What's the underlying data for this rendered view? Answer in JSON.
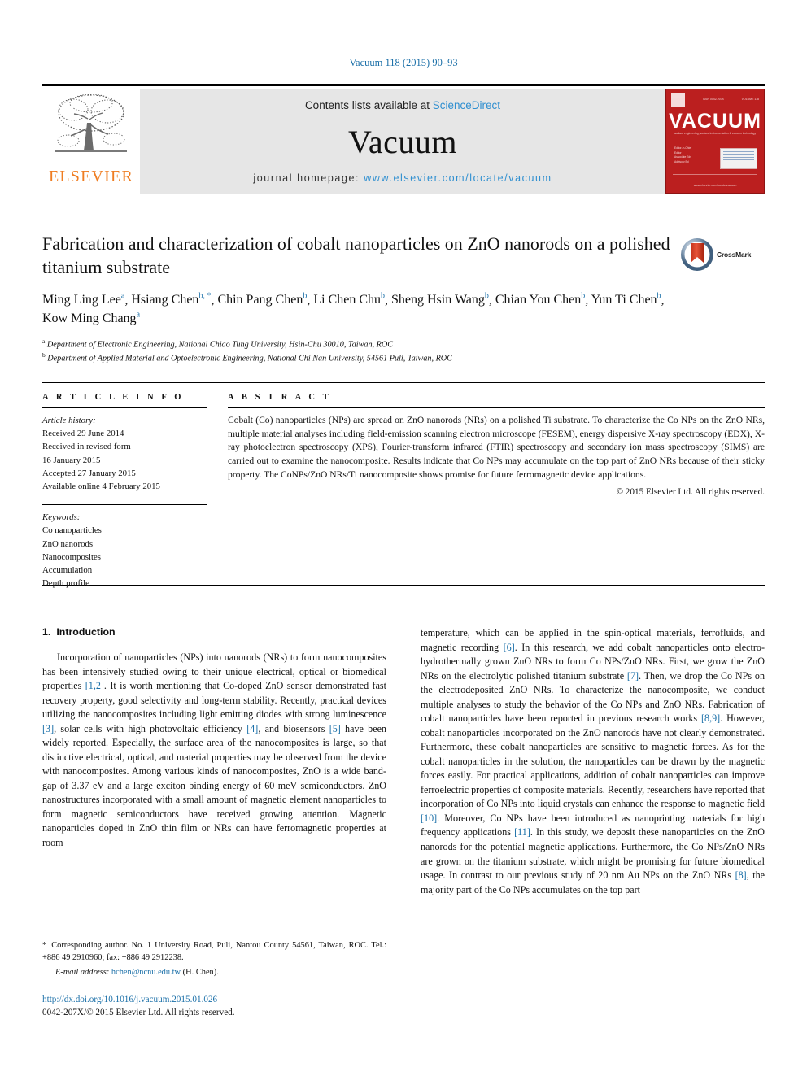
{
  "running_head": "Vacuum 118 (2015) 90–93",
  "masthead": {
    "publisher_name": "ELSEVIER",
    "publisher_logo_name": "elsevier-tree-logo",
    "contents_prefix": "Contents lists available at ",
    "contents_link": "ScienceDirect",
    "journal_title": "Vacuum",
    "homepage_prefix": "journal homepage: ",
    "homepage_url": "www.elsevier.com/locate/vacuum",
    "cover": {
      "title": "VACUUM",
      "top_left": "ELSEVIER",
      "top_center": "ISSN 0042-207X",
      "top_right": "VOLUME 118",
      "subtitle": "surface engineering, surface instrumentation & vacuum technology",
      "editors_label": "Editor-in-Chief",
      "foot": "www.elsevier.com/locate/vacuum",
      "list_left": [
        "Editor-in-Chief",
        "Editor",
        "Associate Editors",
        "Editorial Advisory"
      ],
      "list_right": [
        "J.W. Bradley",
        "R.J. Reid",
        "L.G. Pettersson",
        "M. Yamamoto",
        "M.Y. Nguyen",
        "P.J. Abrahams",
        "Review Coordinator"
      ]
    }
  },
  "article": {
    "title": "Fabrication and characterization of cobalt nanoparticles on ZnO nanorods on a polished titanium substrate",
    "authors": [
      {
        "name": "Ming Ling Lee",
        "marks": "a"
      },
      {
        "name": "Hsiang Chen",
        "marks": "b, *"
      },
      {
        "name": "Chin Pang Chen",
        "marks": "b"
      },
      {
        "name": "Li Chen Chu",
        "marks": "b"
      },
      {
        "name": "Sheng Hsin Wang",
        "marks": "b"
      },
      {
        "name": "Chian You Chen",
        "marks": "b"
      },
      {
        "name": "Yun Ti Chen",
        "marks": "b"
      },
      {
        "name": "Kow Ming Chang",
        "marks": "a"
      }
    ],
    "affiliations": [
      {
        "mark": "a",
        "text": "Department of Electronic Engineering, National Chiao Tung University, Hsin-Chu 30010, Taiwan, ROC"
      },
      {
        "mark": "b",
        "text": "Department of Applied Material and Optoelectronic Engineering, National Chi Nan University, 54561 Puli, Taiwan, ROC"
      }
    ],
    "crossmark_label": "CrossMark"
  },
  "article_info": {
    "heading": "A R T I C L E   I N F O",
    "history_label": "Article history:",
    "history": [
      "Received 29 June 2014",
      "Received in revised form",
      "16 January 2015",
      "Accepted 27 January 2015",
      "Available online 4 February 2015"
    ],
    "keywords_label": "Keywords:",
    "keywords": [
      "Co nanoparticles",
      "ZnO nanorods",
      "Nanocomposites",
      "Accumulation",
      "Depth profile"
    ]
  },
  "abstract": {
    "heading": "A B S T R A C T",
    "text": "Cobalt (Co) nanoparticles (NPs) are spread on ZnO nanorods (NRs) on a polished Ti substrate. To characterize the Co NPs on the ZnO NRs, multiple material analyses including field-emission scanning electron microscope (FESEM), energy dispersive X-ray spectroscopy (EDX), X-ray photoelectron spectroscopy (XPS), Fourier-transform infrared (FTIR) spectroscopy and secondary ion mass spectroscopy (SIMS) are carried out to examine the nanocomposite. Results indicate that Co NPs may accumulate on the top part of ZnO NRs because of their sticky property. The CoNPs/ZnO NRs/Ti nanocomposite shows promise for future ferromagnetic device applications.",
    "copyright": "© 2015 Elsevier Ltd. All rights reserved."
  },
  "body": {
    "section_number": "1.",
    "section_title": "Introduction",
    "left_paragraph_part1": "Incorporation of nanoparticles (NPs) into nanorods (NRs) to form nanocomposites has been intensively studied owing to their unique electrical, optical or biomedical properties ",
    "ref_12": "[1,2]",
    "left_paragraph_part2": ". It is worth mentioning that Co-doped ZnO sensor demonstrated fast recovery property, good selectivity and long-term stability. Recently, practical devices utilizing the nanocomposites including light emitting diodes with strong luminescence ",
    "ref_3": "[3]",
    "left_paragraph_part3": ", solar cells with high photovoltaic efficiency ",
    "ref_4": "[4]",
    "left_paragraph_part4": ", and biosensors ",
    "ref_5": "[5]",
    "left_paragraph_part5": " have been widely reported. Especially, the surface area of the nanocomposites is large, so that distinctive electrical, optical, and material properties may be observed from the device with nanocomposites. Among various kinds of nanocomposites, ZnO is a wide band-gap of 3.37 eV and a large exciton binding energy of 60 meV semiconductors. ZnO nanostructures incorporated with a small amount of magnetic element nanoparticles to form magnetic semiconductors have received growing attention. Magnetic nanoparticles doped in ZnO thin film or NRs can have ferromagnetic properties at room",
    "right_part1": "temperature, which can be applied in the spin-optical materials, ferrofluids, and magnetic recording ",
    "ref_6": "[6]",
    "right_part2": ". In this research, we add cobalt nanoparticles onto electro-hydrothermally grown ZnO NRs to form Co NPs/ZnO NRs. First, we grow the ZnO NRs on the electrolytic polished titanium substrate ",
    "ref_7": "[7]",
    "right_part3": ". Then, we drop the Co NPs on the electrodeposited ZnO NRs. To characterize the nanocomposite, we conduct multiple analyses to study the behavior of the Co NPs and ZnO NRs. Fabrication of cobalt nanoparticles have been reported in previous research works ",
    "ref_89": "[8,9]",
    "right_part4": ". However, cobalt nanoparticles incorporated on the ZnO nanorods have not clearly demonstrated. Furthermore, these cobalt nanoparticles are sensitive to magnetic forces. As for the cobalt nanoparticles in the solution, the nanoparticles can be drawn by the magnetic forces easily. For practical applications, addition of cobalt nanoparticles can improve ferroelectric properties of composite materials. Recently, researchers have reported that incorporation of Co NPs into liquid crystals can enhance the response to magnetic field ",
    "ref_10": "[10]",
    "right_part5": ". Moreover, Co NPs have been introduced as nanoprinting materials for high frequency applications ",
    "ref_11": "[11]",
    "right_part6": ". In this study, we deposit these nanoparticles on the ZnO nanorods for the potential magnetic applications. Furthermore, the Co NPs/ZnO NRs are grown on the titanium substrate, which might be promising for future biomedical usage. In contrast to our previous study of 20 nm Au NPs on the ZnO NRs ",
    "ref_8b": "[8]",
    "right_part7": ", the majority part of the Co NPs accumulates on the top part"
  },
  "footnote": {
    "star": "*",
    "corresponding": " Corresponding author. No. 1 University Road, Puli, Nantou County 54561, Taiwan, ROC. Tel.: +886 49 2910960; fax: +886 49 2912238.",
    "email_label": "E-mail address:",
    "email": "hchen@ncnu.edu.tw",
    "email_suffix": " (H. Chen).",
    "doi": "http://dx.doi.org/10.1016/j.vacuum.2015.01.026",
    "issn": "0042-207X/© 2015 Elsevier Ltd. All rights reserved."
  },
  "colors": {
    "link": "#1a6fa8",
    "sciencedirect": "#2f8fd0",
    "elsevier_orange": "#ef7d22",
    "cover_red": "#bb1f1f"
  }
}
